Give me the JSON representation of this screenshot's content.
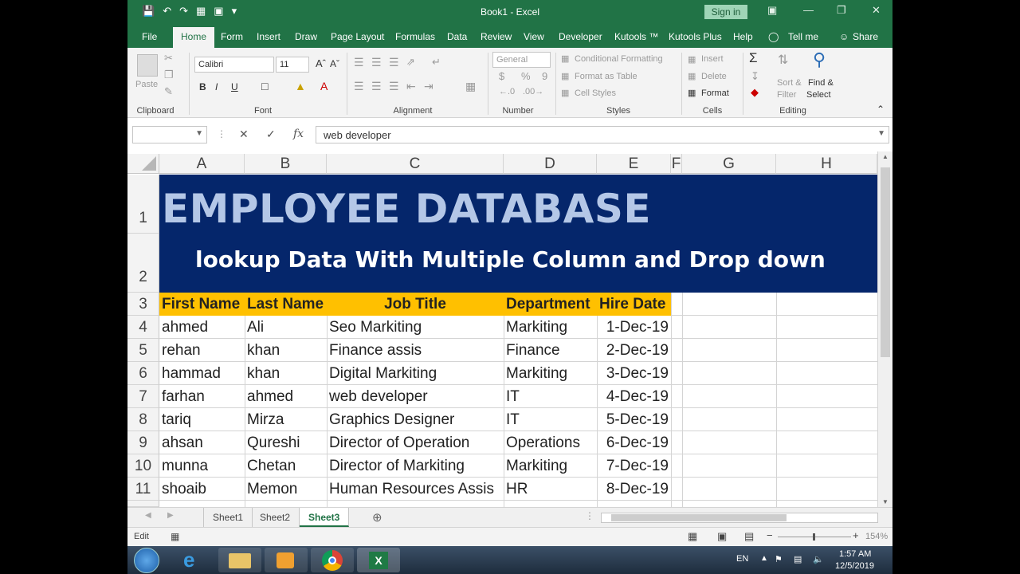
{
  "titlebar": {
    "title": "Book1  -  Excel",
    "signin": "Sign in"
  },
  "tabs": [
    "File",
    "Home",
    "Form",
    "Insert",
    "Draw",
    "Page Layout",
    "Formulas",
    "Data",
    "Review",
    "View",
    "Developer",
    "Kutools ™",
    "Kutools Plus",
    "Help",
    "Tell me",
    "Share"
  ],
  "ribbon": {
    "clipboard": {
      "label": "Clipboard",
      "paste": "Paste"
    },
    "font": {
      "label": "Font",
      "name": "Calibri",
      "size": "11",
      "bold": "B",
      "italic": "I",
      "underline": "U"
    },
    "alignment": {
      "label": "Alignment"
    },
    "number": {
      "label": "Number",
      "format": "General",
      "currency": "$",
      "percent": "%",
      "comma": "9"
    },
    "styles": {
      "label": "Styles",
      "conditional": "Conditional Formatting",
      "format_table": "Format as Table",
      "cell_styles": "Cell Styles"
    },
    "cells": {
      "label": "Cells",
      "insert": "Insert",
      "delete": "Delete",
      "format": "Format"
    },
    "editing": {
      "label": "Editing",
      "sort1": "Sort &",
      "sort2": "Filter",
      "find1": "Find &",
      "find2": "Select"
    }
  },
  "formula_bar": {
    "name_box": "",
    "cancel": "✕",
    "enter": "✓",
    "fx": "fx",
    "value": "web developer"
  },
  "columns": [
    "A",
    "B",
    "C",
    "D",
    "E",
    "F",
    "G",
    "H"
  ],
  "row_numbers": [
    "1",
    "2",
    "3",
    "4",
    "5",
    "6",
    "7",
    "8",
    "9",
    "10",
    "11"
  ],
  "banner": {
    "title": "EMPLOYEE DATABASE",
    "subtitle": "lookup Data With Multiple Column and Drop down"
  },
  "table": {
    "headers": [
      "First Name",
      "Last Name",
      "Job Title",
      "Department",
      "Hire Date"
    ],
    "rows": [
      [
        "ahmed",
        "Ali",
        "Seo Markiting",
        "Markiting",
        "1-Dec-19"
      ],
      [
        "rehan",
        "khan",
        "Finance assis",
        "Finance",
        "2-Dec-19"
      ],
      [
        "hammad",
        "khan",
        "Digital Markiting",
        "Markiting",
        "3-Dec-19"
      ],
      [
        "farhan",
        "ahmed",
        "web developer",
        "IT",
        "4-Dec-19"
      ],
      [
        "tariq",
        "Mirza",
        "Graphics Designer",
        "IT",
        "5-Dec-19"
      ],
      [
        "ahsan",
        "Qureshi",
        "Director of Operation",
        "Operations",
        "6-Dec-19"
      ],
      [
        "munna",
        "Chetan",
        "Director of Markiting",
        "Markiting",
        "7-Dec-19"
      ],
      [
        "shoaib",
        "Memon",
        "Human Resources Assis",
        "HR",
        "8-Dec-19"
      ]
    ]
  },
  "sheets": [
    "Sheet1",
    "Sheet2",
    "Sheet3"
  ],
  "active_sheet": "Sheet3",
  "status": {
    "mode": "Edit",
    "zoom": "154%"
  },
  "taskbar": {
    "lang": "EN",
    "time": "1:57 AM",
    "date": "12/5/2019"
  },
  "colors": {
    "excel_green": "#217346",
    "banner_bg": "#05266b",
    "banner_title": "#b4c7e7",
    "header_fill": "#ffc000"
  }
}
